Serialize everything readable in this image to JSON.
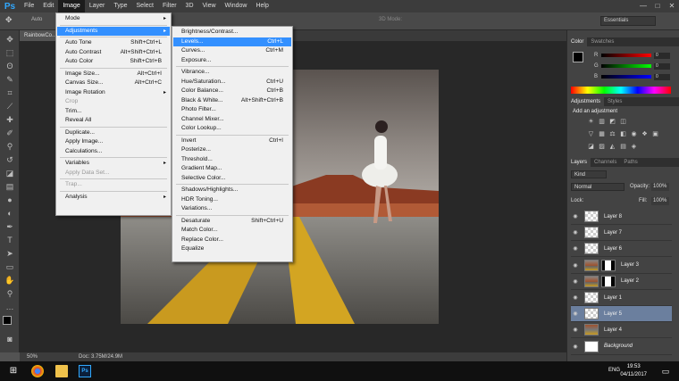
{
  "app": {
    "logo": "Ps"
  },
  "menubar": [
    "File",
    "Edit",
    "Image",
    "Layer",
    "Type",
    "Select",
    "Filter",
    "3D",
    "View",
    "Window",
    "Help"
  ],
  "window_controls": [
    "—",
    "□",
    "✕"
  ],
  "options_bar": {
    "tool_label": "Auto",
    "mode3d": "3D Mode:",
    "workspace": "Essentials"
  },
  "document": {
    "tab": "RainbowCo...",
    "zoom": "50%",
    "doc_info": "Doc: 3.75M/24.9M"
  },
  "image_menu": [
    {
      "label": "Mode",
      "arrow": "▸"
    },
    {
      "sep": true
    },
    {
      "label": "Adjustments",
      "arrow": "▸",
      "highlight": true
    },
    {
      "sep": true
    },
    {
      "label": "Auto Tone",
      "shortcut": "Shift+Ctrl+L"
    },
    {
      "label": "Auto Contrast",
      "shortcut": "Alt+Shift+Ctrl+L"
    },
    {
      "label": "Auto Color",
      "shortcut": "Shift+Ctrl+B"
    },
    {
      "sep": true
    },
    {
      "label": "Image Size...",
      "shortcut": "Alt+Ctrl+I"
    },
    {
      "label": "Canvas Size...",
      "shortcut": "Alt+Ctrl+C"
    },
    {
      "label": "Image Rotation",
      "arrow": "▸"
    },
    {
      "label": "Crop",
      "disabled": true
    },
    {
      "label": "Trim..."
    },
    {
      "label": "Reveal All"
    },
    {
      "sep": true
    },
    {
      "label": "Duplicate..."
    },
    {
      "label": "Apply Image..."
    },
    {
      "label": "Calculations..."
    },
    {
      "sep": true
    },
    {
      "label": "Variables",
      "arrow": "▸"
    },
    {
      "label": "Apply Data Set...",
      "disabled": true
    },
    {
      "sep": true
    },
    {
      "label": "Trap...",
      "disabled": true
    },
    {
      "sep": true
    },
    {
      "label": "Analysis",
      "arrow": "▸"
    }
  ],
  "adjustments_menu": [
    {
      "label": "Brightness/Contrast..."
    },
    {
      "label": "Levels...",
      "shortcut": "Ctrl+L",
      "highlight": true
    },
    {
      "label": "Curves...",
      "shortcut": "Ctrl+M"
    },
    {
      "label": "Exposure..."
    },
    {
      "sep": true
    },
    {
      "label": "Vibrance..."
    },
    {
      "label": "Hue/Saturation...",
      "shortcut": "Ctrl+U"
    },
    {
      "label": "Color Balance...",
      "shortcut": "Ctrl+B"
    },
    {
      "label": "Black & White...",
      "shortcut": "Alt+Shift+Ctrl+B"
    },
    {
      "label": "Photo Filter..."
    },
    {
      "label": "Channel Mixer..."
    },
    {
      "label": "Color Lookup..."
    },
    {
      "sep": true
    },
    {
      "label": "Invert",
      "shortcut": "Ctrl+I"
    },
    {
      "label": "Posterize..."
    },
    {
      "label": "Threshold..."
    },
    {
      "label": "Gradient Map..."
    },
    {
      "label": "Selective Color..."
    },
    {
      "sep": true
    },
    {
      "label": "Shadows/Highlights..."
    },
    {
      "label": "HDR Toning..."
    },
    {
      "label": "Variations..."
    },
    {
      "sep": true
    },
    {
      "label": "Desaturate",
      "shortcut": "Shift+Ctrl+U"
    },
    {
      "label": "Match Color..."
    },
    {
      "label": "Replace Color..."
    },
    {
      "label": "Equalize"
    }
  ],
  "color_panel": {
    "tabs": [
      "Color",
      "Swatches"
    ],
    "rows": [
      {
        "letter": "R",
        "value": "0"
      },
      {
        "letter": "G",
        "value": "0"
      },
      {
        "letter": "B",
        "value": "0"
      }
    ]
  },
  "adjustments_panel": {
    "tabs": [
      "Adjustments",
      "Styles"
    ],
    "title": "Add an adjustment"
  },
  "layers_panel": {
    "tabs": [
      "Layers",
      "Channels",
      "Paths"
    ],
    "kind": "Kind",
    "blend_mode": "Normal",
    "opacity_label": "Opacity:",
    "opacity": "100%",
    "lock_label": "Lock:",
    "fill_label": "Fill:",
    "fill": "100%",
    "layers": [
      {
        "name": "Layer 8"
      },
      {
        "name": "Layer 7"
      },
      {
        "name": "Layer 6"
      },
      {
        "name": "Layer 3",
        "mask": true
      },
      {
        "name": "Layer 2",
        "mask": true
      },
      {
        "name": "Layer 1"
      },
      {
        "name": "Layer 5",
        "selected": true
      },
      {
        "name": "Layer 4"
      },
      {
        "name": "Background"
      }
    ]
  },
  "taskbar": {
    "lang": "ENG",
    "time": "19:53",
    "date": "04/11/2017"
  },
  "colors": {
    "highlight": "#3390ff",
    "layer_selected": "#6b7f9e",
    "ps_blue": "#31a8ff"
  }
}
